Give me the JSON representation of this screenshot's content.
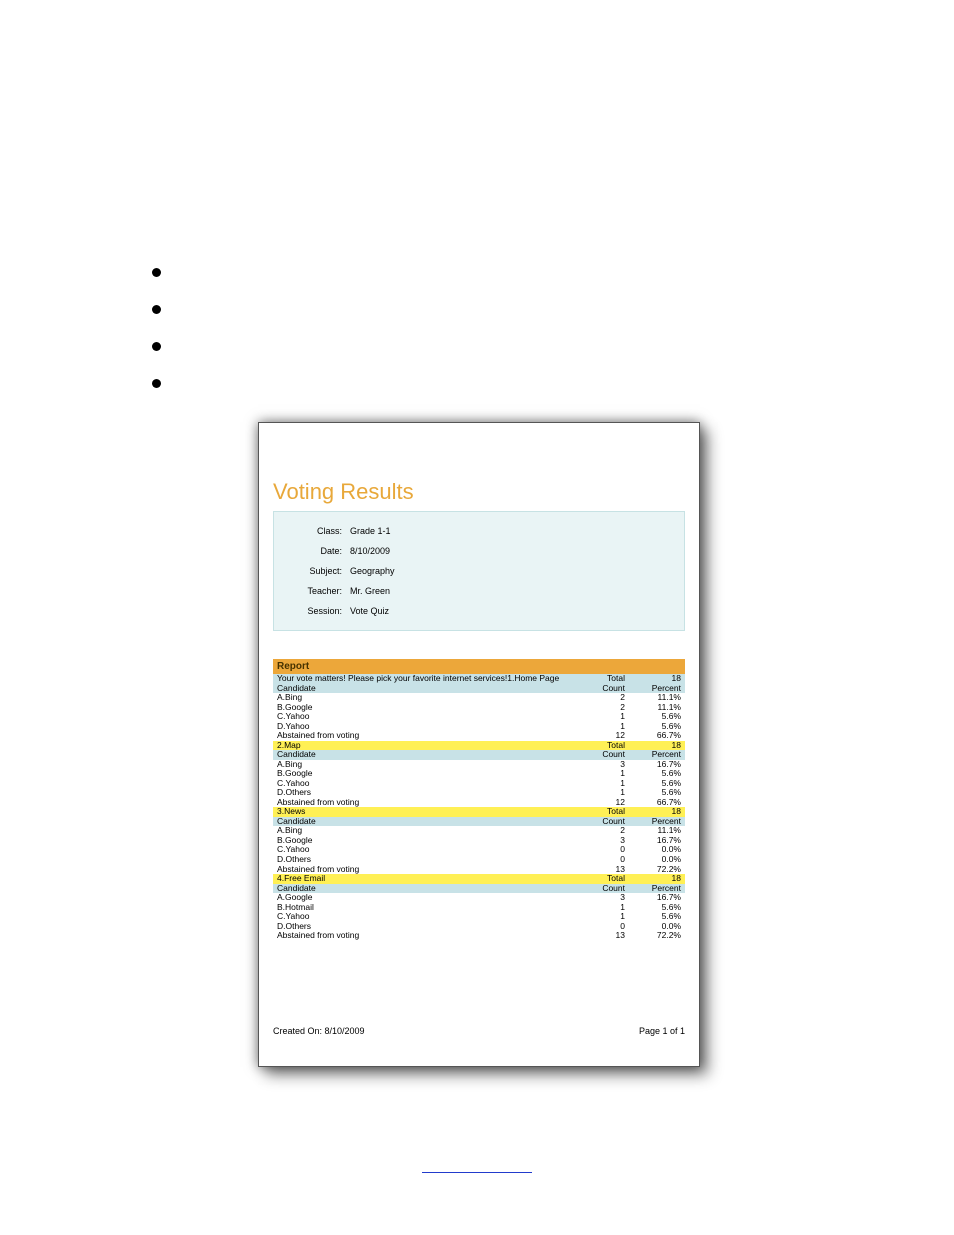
{
  "title": "Voting Results",
  "info": {
    "class_label": "Class:",
    "class_value": "Grade 1-1",
    "date_label": "Date:",
    "date_value": "8/10/2009",
    "subject_label": "Subject:",
    "subject_value": "Geography",
    "teacher_label": "Teacher:",
    "teacher_value": "Mr. Green",
    "session_label": "Session:",
    "session_value": "Vote Quiz"
  },
  "report_header": "Report",
  "q_prompt": "Your vote matters! Please pick your favorite internet services!1.Home Page",
  "total_label": "Total",
  "candidate_label": "Candidate",
  "count_label": "Count",
  "percent_label": "Percent",
  "abstain_label": "Abstained from voting",
  "questions": [
    {
      "header": "",
      "total": "18",
      "rows": [
        {
          "name": "A.Bing",
          "count": "2",
          "pct": "11.1%"
        },
        {
          "name": "B.Google",
          "count": "2",
          "pct": "11.1%"
        },
        {
          "name": "C.Yahoo",
          "count": "1",
          "pct": "5.6%"
        },
        {
          "name": "D.Yahoo",
          "count": "1",
          "pct": "5.6%"
        }
      ],
      "abstain_count": "12",
      "abstain_pct": "66.7%"
    },
    {
      "header": "2.Map",
      "total": "18",
      "rows": [
        {
          "name": "A.Bing",
          "count": "3",
          "pct": "16.7%"
        },
        {
          "name": "B.Google",
          "count": "1",
          "pct": "5.6%"
        },
        {
          "name": "C.Yahoo",
          "count": "1",
          "pct": "5.6%"
        },
        {
          "name": "D.Others",
          "count": "1",
          "pct": "5.6%"
        }
      ],
      "abstain_count": "12",
      "abstain_pct": "66.7%"
    },
    {
      "header": "3.News",
      "total": "18",
      "rows": [
        {
          "name": "A.Bing",
          "count": "2",
          "pct": "11.1%"
        },
        {
          "name": "B.Google",
          "count": "3",
          "pct": "16.7%"
        },
        {
          "name": "C.Yahoo",
          "count": "0",
          "pct": "0.0%"
        },
        {
          "name": "D.Others",
          "count": "0",
          "pct": "0.0%"
        }
      ],
      "abstain_count": "13",
      "abstain_pct": "72.2%"
    },
    {
      "header": "4.Free Email",
      "total": "18",
      "rows": [
        {
          "name": "A.Google",
          "count": "3",
          "pct": "16.7%"
        },
        {
          "name": "B.Hotmail",
          "count": "1",
          "pct": "5.6%"
        },
        {
          "name": "C.Yahoo",
          "count": "1",
          "pct": "5.6%"
        },
        {
          "name": "D.Others",
          "count": "0",
          "pct": "0.0%"
        }
      ],
      "abstain_count": "13",
      "abstain_pct": "72.2%"
    }
  ],
  "footer": {
    "created": "Created On: 8/10/2009",
    "page": "Page 1 of 1"
  }
}
